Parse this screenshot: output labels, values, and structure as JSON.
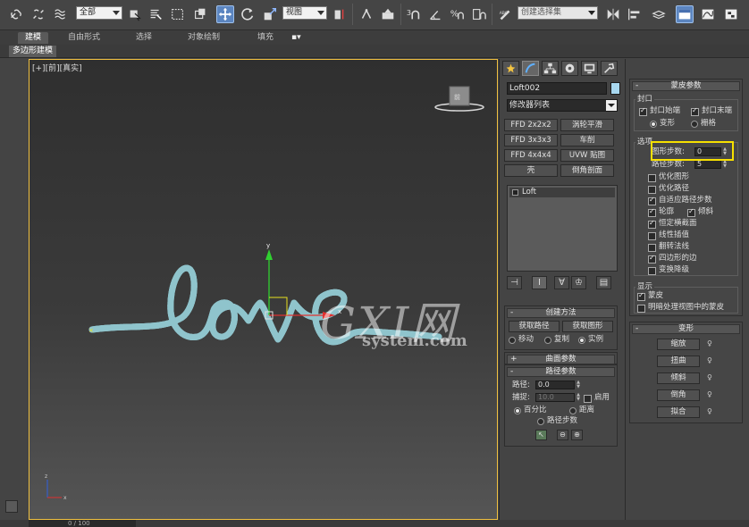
{
  "toolbar": {
    "selection_filter": "全部",
    "ref_coord": "视图",
    "named_selection": "创建选择集"
  },
  "ribbon": {
    "tabs": [
      "建模",
      "自由形式",
      "选择",
      "对象绘制",
      "填充"
    ],
    "active_tab": "建模",
    "sub_label": "多边形建模"
  },
  "viewport": {
    "label": "[+][前][真实]",
    "watermark_main": "GXI网",
    "watermark_sub": "system.com",
    "timeline": "0 / 100"
  },
  "command_panel": {
    "object_name": "Loft002",
    "object_color": "#a8d8f0",
    "modifier_list": "修改器列表",
    "modifier_buttons": [
      "FFD 2x2x2",
      "涡轮平滑",
      "FFD 3x3x3",
      "车削",
      "FFD 4x4x4",
      "UVW 贴图",
      "壳",
      "倒角剖面"
    ],
    "stack_item": "Loft",
    "creation_method": {
      "title": "创建方法",
      "get_path": "获取路径",
      "get_shape": "获取图形",
      "move": "移动",
      "copy": "复制",
      "instance": "实例"
    },
    "surface_params": {
      "title": "曲面参数"
    },
    "path_params": {
      "title": "路径参数",
      "path_label": "路径:",
      "path_value": "0.0",
      "snap_label": "捕捉:",
      "snap_value": "10.0",
      "enable": "启用",
      "percent": "百分比",
      "distance": "距离",
      "path_steps": "路径步数"
    }
  },
  "skin_params": {
    "title": "蒙皮参数",
    "capping": {
      "title": "封口",
      "cap_start": "封口始端",
      "cap_end": "封口末端",
      "morph": "变形",
      "grid": "栅格"
    },
    "options": {
      "title": "选项",
      "shape_steps_label": "图形步数:",
      "shape_steps_value": "0",
      "path_steps_label": "路径步数:",
      "path_steps_value": "5",
      "optimize_shapes": "优化图形",
      "optimize_path": "优化路径",
      "adaptive_path_steps": "自适应路径步数",
      "contour": "轮廓",
      "banking": "倾斜",
      "constant_cross_section": "恒定横截面",
      "linear_interpolation": "线性插值",
      "flip_normals": "翻转法线",
      "quad_sides": "四边形的边",
      "transform_degrade": "变换降级"
    },
    "display": {
      "title": "显示",
      "skin": "蒙皮",
      "skin_in_shaded": "明暗处理视图中的蒙皮"
    }
  },
  "deform": {
    "title": "变形",
    "buttons": [
      "缩放",
      "扭曲",
      "倾斜",
      "倒角",
      "拟合"
    ]
  },
  "colors": {
    "highlight": "#f7e000",
    "active_blue": "#5b85c0",
    "loft_cyan": "#bfe8ef"
  }
}
